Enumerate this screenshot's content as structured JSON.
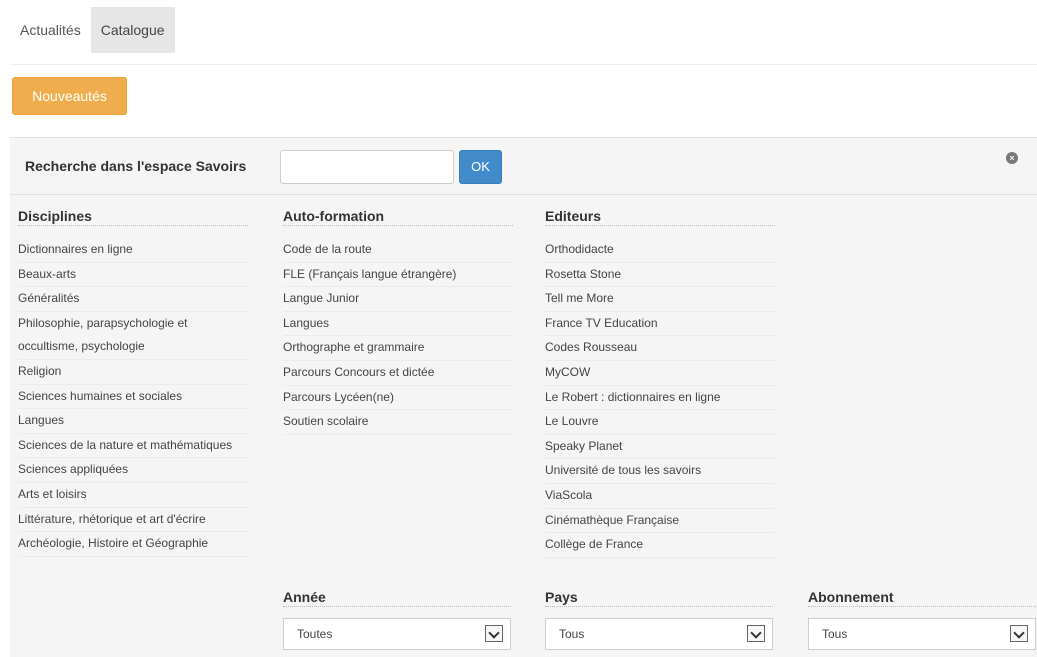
{
  "tabs": [
    {
      "label": "Actualités",
      "active": false
    },
    {
      "label": "Catalogue",
      "active": true
    }
  ],
  "news_button": "Nouveautés",
  "search": {
    "label": "Recherche dans l'espace Savoirs",
    "value": "",
    "placeholder": "",
    "button": "OK"
  },
  "columns": {
    "disciplines": {
      "title": "Disciplines",
      "items": [
        "Dictionnaires en ligne",
        "Beaux-arts",
        "Généralités",
        "Philosophie, parapsychologie et occultisme, psychologie",
        "Religion",
        "Sciences humaines et sociales",
        "Langues",
        "Sciences de la nature et mathématiques",
        "Sciences appliquées",
        "Arts et loisirs",
        "Littérature, rhétorique et art d'écrire",
        "Archéologie, Histoire et Géographie"
      ]
    },
    "autoformation": {
      "title": "Auto-formation",
      "items": [
        "Code de la route",
        "FLE (Français langue étrangère)",
        "Langue Junior",
        "Langues",
        "Orthographe et grammaire",
        "Parcours Concours et dictée",
        "Parcours Lycéen(ne)",
        "Soutien scolaire"
      ]
    },
    "editeurs": {
      "title": "Editeurs",
      "items": [
        "Orthodidacte",
        "Rosetta Stone",
        "Tell me More",
        "France TV Education",
        "Codes Rousseau",
        "MyCOW",
        "Le Robert : dictionnaires en ligne",
        "Le Louvre",
        "Speaky Planet",
        "Université de tous les savoirs",
        "ViaScola",
        "Cinémathèque Française",
        "Collège de France"
      ]
    }
  },
  "filters": {
    "annee": {
      "title": "Année",
      "value": "Toutes"
    },
    "pays": {
      "title": "Pays",
      "value": "Tous"
    },
    "abonnement": {
      "title": "Abonnement",
      "value": "Tous"
    }
  },
  "icons": {
    "close": "close-icon",
    "dropdown": "chevron-down-icon"
  },
  "colors": {
    "news_button": "#f0ad4e",
    "ok_button": "#428bca",
    "panel_bg": "#f5f5f5",
    "active_tab_bg": "#e6e6e6"
  }
}
